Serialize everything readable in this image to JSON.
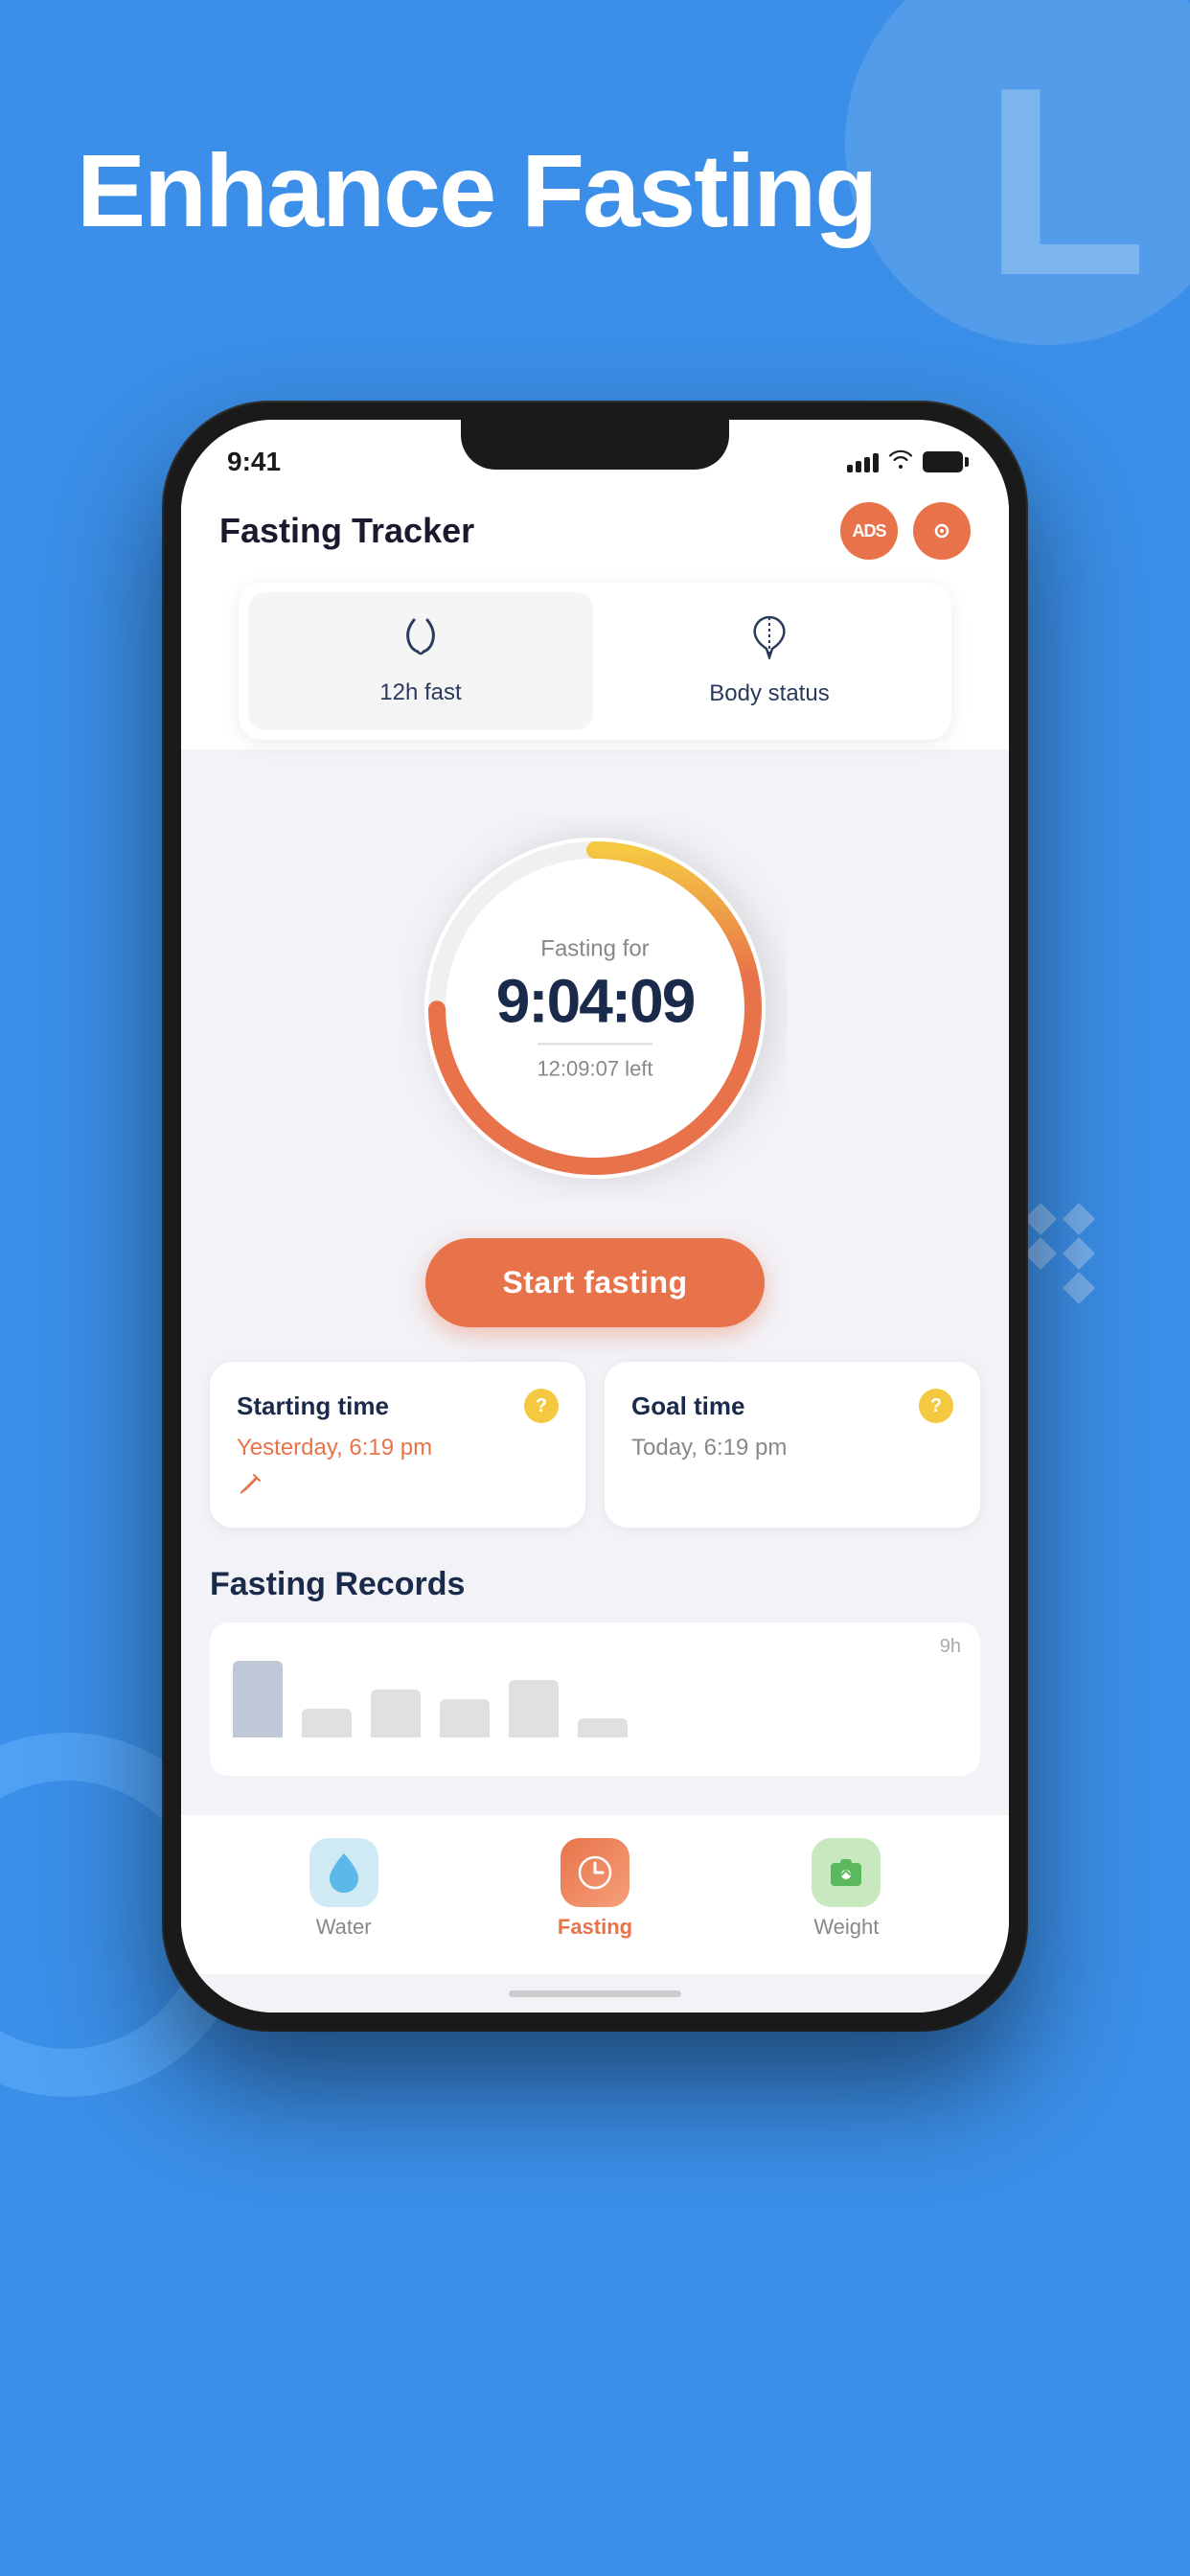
{
  "background": {
    "color": "#3B8FE8"
  },
  "headline": {
    "text": "Enhance Fasting"
  },
  "clock_letter": "L",
  "status_bar": {
    "time": "9:41",
    "signal_bars": [
      8,
      12,
      16,
      20
    ],
    "wifi": "wifi",
    "battery": "battery"
  },
  "app_header": {
    "title": "Fasting Tracker",
    "ads_btn": "ADS",
    "settings_btn": "⊙"
  },
  "mode_tabs": [
    {
      "icon": "⌁",
      "label": "12h fast",
      "active": true
    },
    {
      "icon": "🌿",
      "label": "Body status",
      "active": false
    }
  ],
  "timer": {
    "fasting_label": "Fasting for",
    "time": "9:04:09",
    "time_left": "12:09:07 left"
  },
  "start_button": {
    "label": "Start fasting"
  },
  "time_cards": [
    {
      "title": "Starting time",
      "value": "Yesterday, 6:19 pm",
      "value_color": "orange",
      "has_edit": true
    },
    {
      "title": "Goal time",
      "value": "Today, 6:19 pm",
      "value_color": "gray",
      "has_edit": false
    }
  ],
  "records": {
    "title": "Fasting Records",
    "chart_max_label": "9h",
    "bars": [
      {
        "height": 80,
        "label": "",
        "active": true
      },
      {
        "height": 30,
        "label": "",
        "active": false
      },
      {
        "height": 50,
        "label": "",
        "active": false
      },
      {
        "height": 40,
        "label": "",
        "active": false
      },
      {
        "height": 60,
        "label": "",
        "active": false
      },
      {
        "height": 20,
        "label": "",
        "active": false
      }
    ]
  },
  "bottom_nav": [
    {
      "label": "Water",
      "icon": "💧",
      "color_class": "water",
      "active": false
    },
    {
      "label": "Fasting",
      "icon": "⏰",
      "color_class": "fasting",
      "active": true
    },
    {
      "label": "Weight",
      "icon": "💬",
      "color_class": "weight",
      "active": false
    }
  ]
}
